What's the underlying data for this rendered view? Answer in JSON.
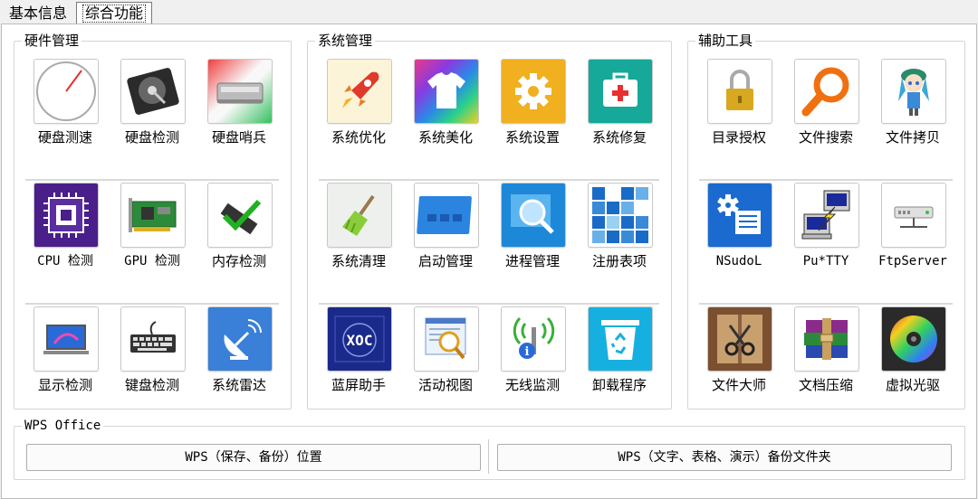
{
  "tabs": {
    "basic": "基本信息",
    "advanced": "综合功能"
  },
  "groups": {
    "hardware": {
      "title": "硬件管理",
      "items": [
        {
          "label": "硬盘测速",
          "icon": "gauge-icon"
        },
        {
          "label": "硬盘检测",
          "icon": "hard-disk-icon"
        },
        {
          "label": "硬盘哨兵",
          "icon": "disk-sentinel-icon"
        },
        {
          "label": "CPU 检测",
          "icon": "cpu-chip-icon"
        },
        {
          "label": "GPU 检测",
          "icon": "graphics-card-icon"
        },
        {
          "label": "内存检测",
          "icon": "memory-check-icon"
        },
        {
          "label": "显示检测",
          "icon": "monitor-icon"
        },
        {
          "label": "键盘检测",
          "icon": "keyboard-icon"
        },
        {
          "label": "系统雷达",
          "icon": "satellite-dish-icon"
        }
      ]
    },
    "system": {
      "title": "系统管理",
      "items": [
        {
          "label": "系统优化",
          "icon": "rocket-icon"
        },
        {
          "label": "系统美化",
          "icon": "tshirt-icon"
        },
        {
          "label": "系统设置",
          "icon": "gear-icon"
        },
        {
          "label": "系统修复",
          "icon": "first-aid-kit-icon"
        },
        {
          "label": "系统清理",
          "icon": "broom-icon"
        },
        {
          "label": "启动管理",
          "icon": "startup-window-icon"
        },
        {
          "label": "进程管理",
          "icon": "process-search-icon"
        },
        {
          "label": "注册表项",
          "icon": "registry-grid-icon"
        },
        {
          "label": "蓝屏助手",
          "icon": "bluescreen-icon"
        },
        {
          "label": "活动视图",
          "icon": "activity-view-icon"
        },
        {
          "label": "无线监测",
          "icon": "wireless-info-icon"
        },
        {
          "label": "卸载程序",
          "icon": "recycle-bin-icon"
        }
      ]
    },
    "tools": {
      "title": "辅助工具",
      "items": [
        {
          "label": "目录授权",
          "icon": "padlock-icon"
        },
        {
          "label": "文件搜索",
          "icon": "magnifier-icon"
        },
        {
          "label": "文件拷贝",
          "icon": "anime-character-icon"
        },
        {
          "label": "NSudoL",
          "icon": "admin-settings-icon"
        },
        {
          "label": "Pu*TTY",
          "icon": "putty-terminal-icon"
        },
        {
          "label": "FtpServer",
          "icon": "ftp-server-icon"
        },
        {
          "label": "文件大师",
          "icon": "scissors-file-icon"
        },
        {
          "label": "文档压缩",
          "icon": "winrar-books-icon"
        },
        {
          "label": "虚拟光驱",
          "icon": "optical-disc-icon"
        }
      ]
    },
    "wps": {
      "title": "WPS Office",
      "buttons": {
        "location": "WPS（保存、备份）位置",
        "backup_folder": "WPS（文字、表格、演示）备份文件夹"
      }
    }
  }
}
